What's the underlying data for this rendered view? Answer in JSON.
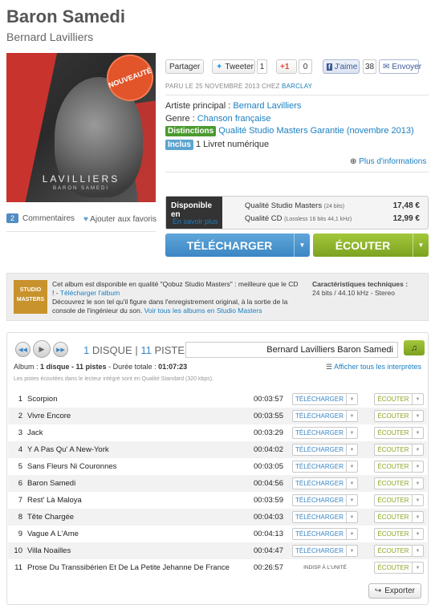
{
  "album": {
    "title": "Baron Samedi",
    "artist": "Bernard Lavilliers",
    "cover_text_1": "LAVILLIERS",
    "cover_text_2": "BARON SAMEDI",
    "new_badge": "NOUVEAUTÉ"
  },
  "social": {
    "partager": "Partager",
    "tweeter": "Tweeter",
    "tweet_count": "1",
    "gplus": "+1",
    "gplus_count": "0",
    "jaime": "J'aime",
    "jaime_count": "38",
    "envoyer": "Envoyer"
  },
  "release": {
    "prefix": "PARU LE 25 NOVEMBRE 2013 CHEZ",
    "label": "BARCLAY"
  },
  "info": {
    "artist_label": "Artiste principal :",
    "artist_value": "Bernard Lavilliers",
    "genre_label": "Genre :",
    "genre_value": "Chanson française",
    "distinctions_tag": "Distinctions",
    "distinctions_value": "Qualité Studio Masters Garantie (novembre 2013)",
    "inclus_tag": "Inclus",
    "inclus_value": "1 Livret numérique",
    "more_info": "Plus d'informations"
  },
  "availability": {
    "title": "Disponible en",
    "link": "En savoir plus",
    "q1_label": "Qualité Studio Masters",
    "q1_detail": "(24 bits)",
    "q1_price": "17,48 €",
    "q2_label": "Qualité CD",
    "q2_detail": "(Lossless 16 bits 44,1 kHz)",
    "q2_price": "12,99 €"
  },
  "actions": {
    "download": "TÉLÉCHARGER",
    "listen": "ÉCOUTER"
  },
  "left_links": {
    "comments_count": "2",
    "comments": "Commentaires",
    "favorites": "Ajouter aux favoris"
  },
  "studio": {
    "logo": "STUDIO MASTERS",
    "text1": "Cet album est disponible en qualité \"Qobuz Studio Masters\" : meilleure que le CD ! -",
    "text1_link": "Télécharger l'album",
    "text2": "Découvrez le son tel qu'il figure dans l'enregistrement original, à la sortie de la console de l'ingénieur du son.",
    "text2_link": "Voir tous les albums en Studio Masters",
    "tech_title": "Caractéristiques techniques :",
    "tech_value": "24 bits / 44.10 kHz - Stereo"
  },
  "player": {
    "disc_n": "1",
    "disc_label": "DISQUE",
    "tracks_n": "11",
    "tracks_label": "PISTES",
    "now_playing": "Bernard Lavilliers Baron Samedi",
    "summary_prefix": "Album :",
    "summary_bold": "1 disque - 11 pistes",
    "summary_mid": "- Durée totale :",
    "summary_duration": "01:07:23",
    "show_all": "Afficher tous les interprètes",
    "note": "Les pistes écoutées dans le lecteur intégré sont en Qualité Standard (320 kbps).",
    "download_label": "TÉLÉCHARGER",
    "listen_label": "ÉCOUTER",
    "unavailable": "INDISP À L'UNITÉ",
    "export": "Exporter"
  },
  "tracks": [
    {
      "num": "1",
      "title": "Scorpion",
      "duration": "00:03:57"
    },
    {
      "num": "2",
      "title": "Vivre Encore",
      "duration": "00:03:55"
    },
    {
      "num": "3",
      "title": "Jack",
      "duration": "00:03:29"
    },
    {
      "num": "4",
      "title": "Y A Pas Qu' A New-York",
      "duration": "00:04:02"
    },
    {
      "num": "5",
      "title": "Sans Fleurs Ni Couronnes",
      "duration": "00:03:05"
    },
    {
      "num": "6",
      "title": "Baron Samedi",
      "duration": "00:04:56"
    },
    {
      "num": "7",
      "title": "Rest' Là Maloya",
      "duration": "00:03:59"
    },
    {
      "num": "8",
      "title": "Tête Chargée",
      "duration": "00:04:03"
    },
    {
      "num": "9",
      "title": "Vague A L'Ame",
      "duration": "00:04:13"
    },
    {
      "num": "10",
      "title": "Villa Noailles",
      "duration": "00:04:47"
    },
    {
      "num": "11",
      "title": "Prose Du Transsibérien Et De La Petite Jehanne De France",
      "duration": "00:26:57"
    }
  ]
}
